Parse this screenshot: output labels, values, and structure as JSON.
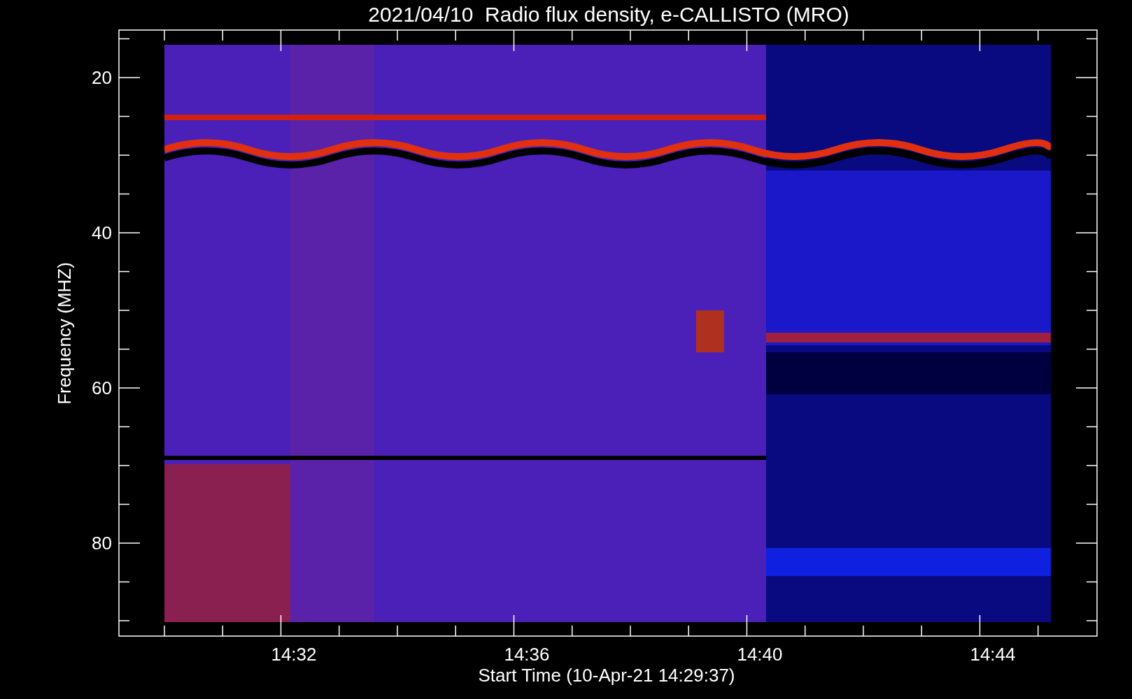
{
  "title": "2021/04/10  Radio flux density, e-CALLISTO (MRO)",
  "y_axis": {
    "label": "Frequency (MHZ)",
    "ticks": [
      "20",
      "40",
      "60",
      "80"
    ]
  },
  "x_axis": {
    "label": "Start Time (10-Apr-21 14:29:37)",
    "ticks": [
      "14:32",
      "14:36",
      "14:40",
      "14:44"
    ]
  }
}
